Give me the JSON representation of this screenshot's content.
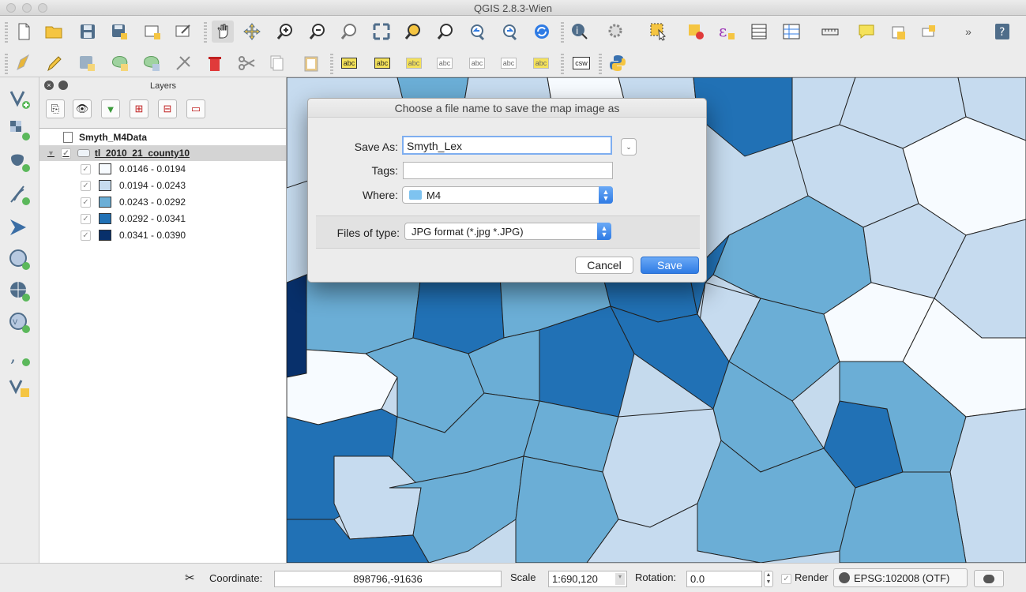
{
  "window": {
    "title": "QGIS 2.8.3-Wien"
  },
  "toolbar1": {
    "icons": [
      "new-project-icon",
      "open-project-icon",
      "save-project-icon",
      "save-as-icon",
      "new-print-composer-icon",
      "composer-manager-icon",
      "pan-icon",
      "pan-to-selection-icon",
      "zoom-in-icon",
      "zoom-out-icon",
      "zoom-actual-icon",
      "zoom-full-icon",
      "zoom-to-selection-icon",
      "zoom-to-layer-icon",
      "zoom-last-icon",
      "zoom-next-icon",
      "refresh-icon",
      "identify-icon",
      "run-action-icon",
      "select-features-icon",
      "deselect-icon",
      "expression-select-icon",
      "attribute-table-icon",
      "field-calculator-icon",
      "measure-icon",
      "map-tips-icon",
      "new-bookmark-icon",
      "show-bookmarks-icon",
      "more-icon",
      "help-icon"
    ],
    "overflow": "»"
  },
  "toolbar2": {
    "icons": [
      "current-edits-icon",
      "toggle-editing-icon",
      "save-edits-icon",
      "add-feature-icon",
      "move-feature-icon",
      "node-tool-icon",
      "delete-selected-icon",
      "cut-features-icon",
      "copy-features-icon",
      "paste-features-icon",
      "label-icon",
      "label-pin-icon",
      "label-highlight-icon",
      "label-show-hide-icon",
      "label-move-icon",
      "label-rotate-icon",
      "label-change-icon",
      "csw-icon",
      "python-console-icon"
    ],
    "label_text": "abc",
    "csw_text": "csw"
  },
  "left_tools": [
    "add-vector-layer-icon",
    "add-raster-layer-icon",
    "add-postgis-layer-icon",
    "add-spatialite-layer-icon",
    "add-mssql-layer-icon",
    "add-wms-layer-icon",
    "add-wcs-layer-icon",
    "add-wfs-layer-icon",
    "add-delimited-text-icon",
    "new-shapefile-icon"
  ],
  "layers_panel": {
    "title": "Layers",
    "group": "Smyth_M4Data",
    "layer": "tl_2010_21_county10",
    "legend": [
      {
        "label": "0.0146 - 0.0194",
        "color": "#f7fbff"
      },
      {
        "label": "0.0194 - 0.0243",
        "color": "#c6dbef"
      },
      {
        "label": "0.0243 - 0.0292",
        "color": "#6baed6"
      },
      {
        "label": "0.0292 - 0.0341",
        "color": "#2171b5"
      },
      {
        "label": "0.0341 - 0.0390",
        "color": "#08306b"
      }
    ]
  },
  "dialog": {
    "title": "Choose a file name to save the map image as",
    "save_as_label": "Save As:",
    "save_as_value": "Smyth_Lex",
    "tags_label": "Tags:",
    "tags_value": "",
    "where_label": "Where:",
    "where_value": "M4",
    "files_of_type_label": "Files of type:",
    "files_of_type_value": "JPG format (*.jpg *.JPG)",
    "cancel_label": "Cancel",
    "save_label": "Save"
  },
  "status_bar": {
    "coordinate_label": "Coordinate:",
    "coordinate_value": "898796,-91636",
    "scale_label": "Scale",
    "scale_value": "1:690,120",
    "rotation_label": "Rotation:",
    "rotation_value": "0.0",
    "render_label": "Render",
    "crs_value": "EPSG:102008 (OTF)"
  },
  "colors": {
    "accent": "#2f7be4",
    "class1": "#f7fbff",
    "class2": "#c6dbef",
    "class3": "#6baed6",
    "class4": "#2171b5",
    "class5": "#08306b"
  }
}
